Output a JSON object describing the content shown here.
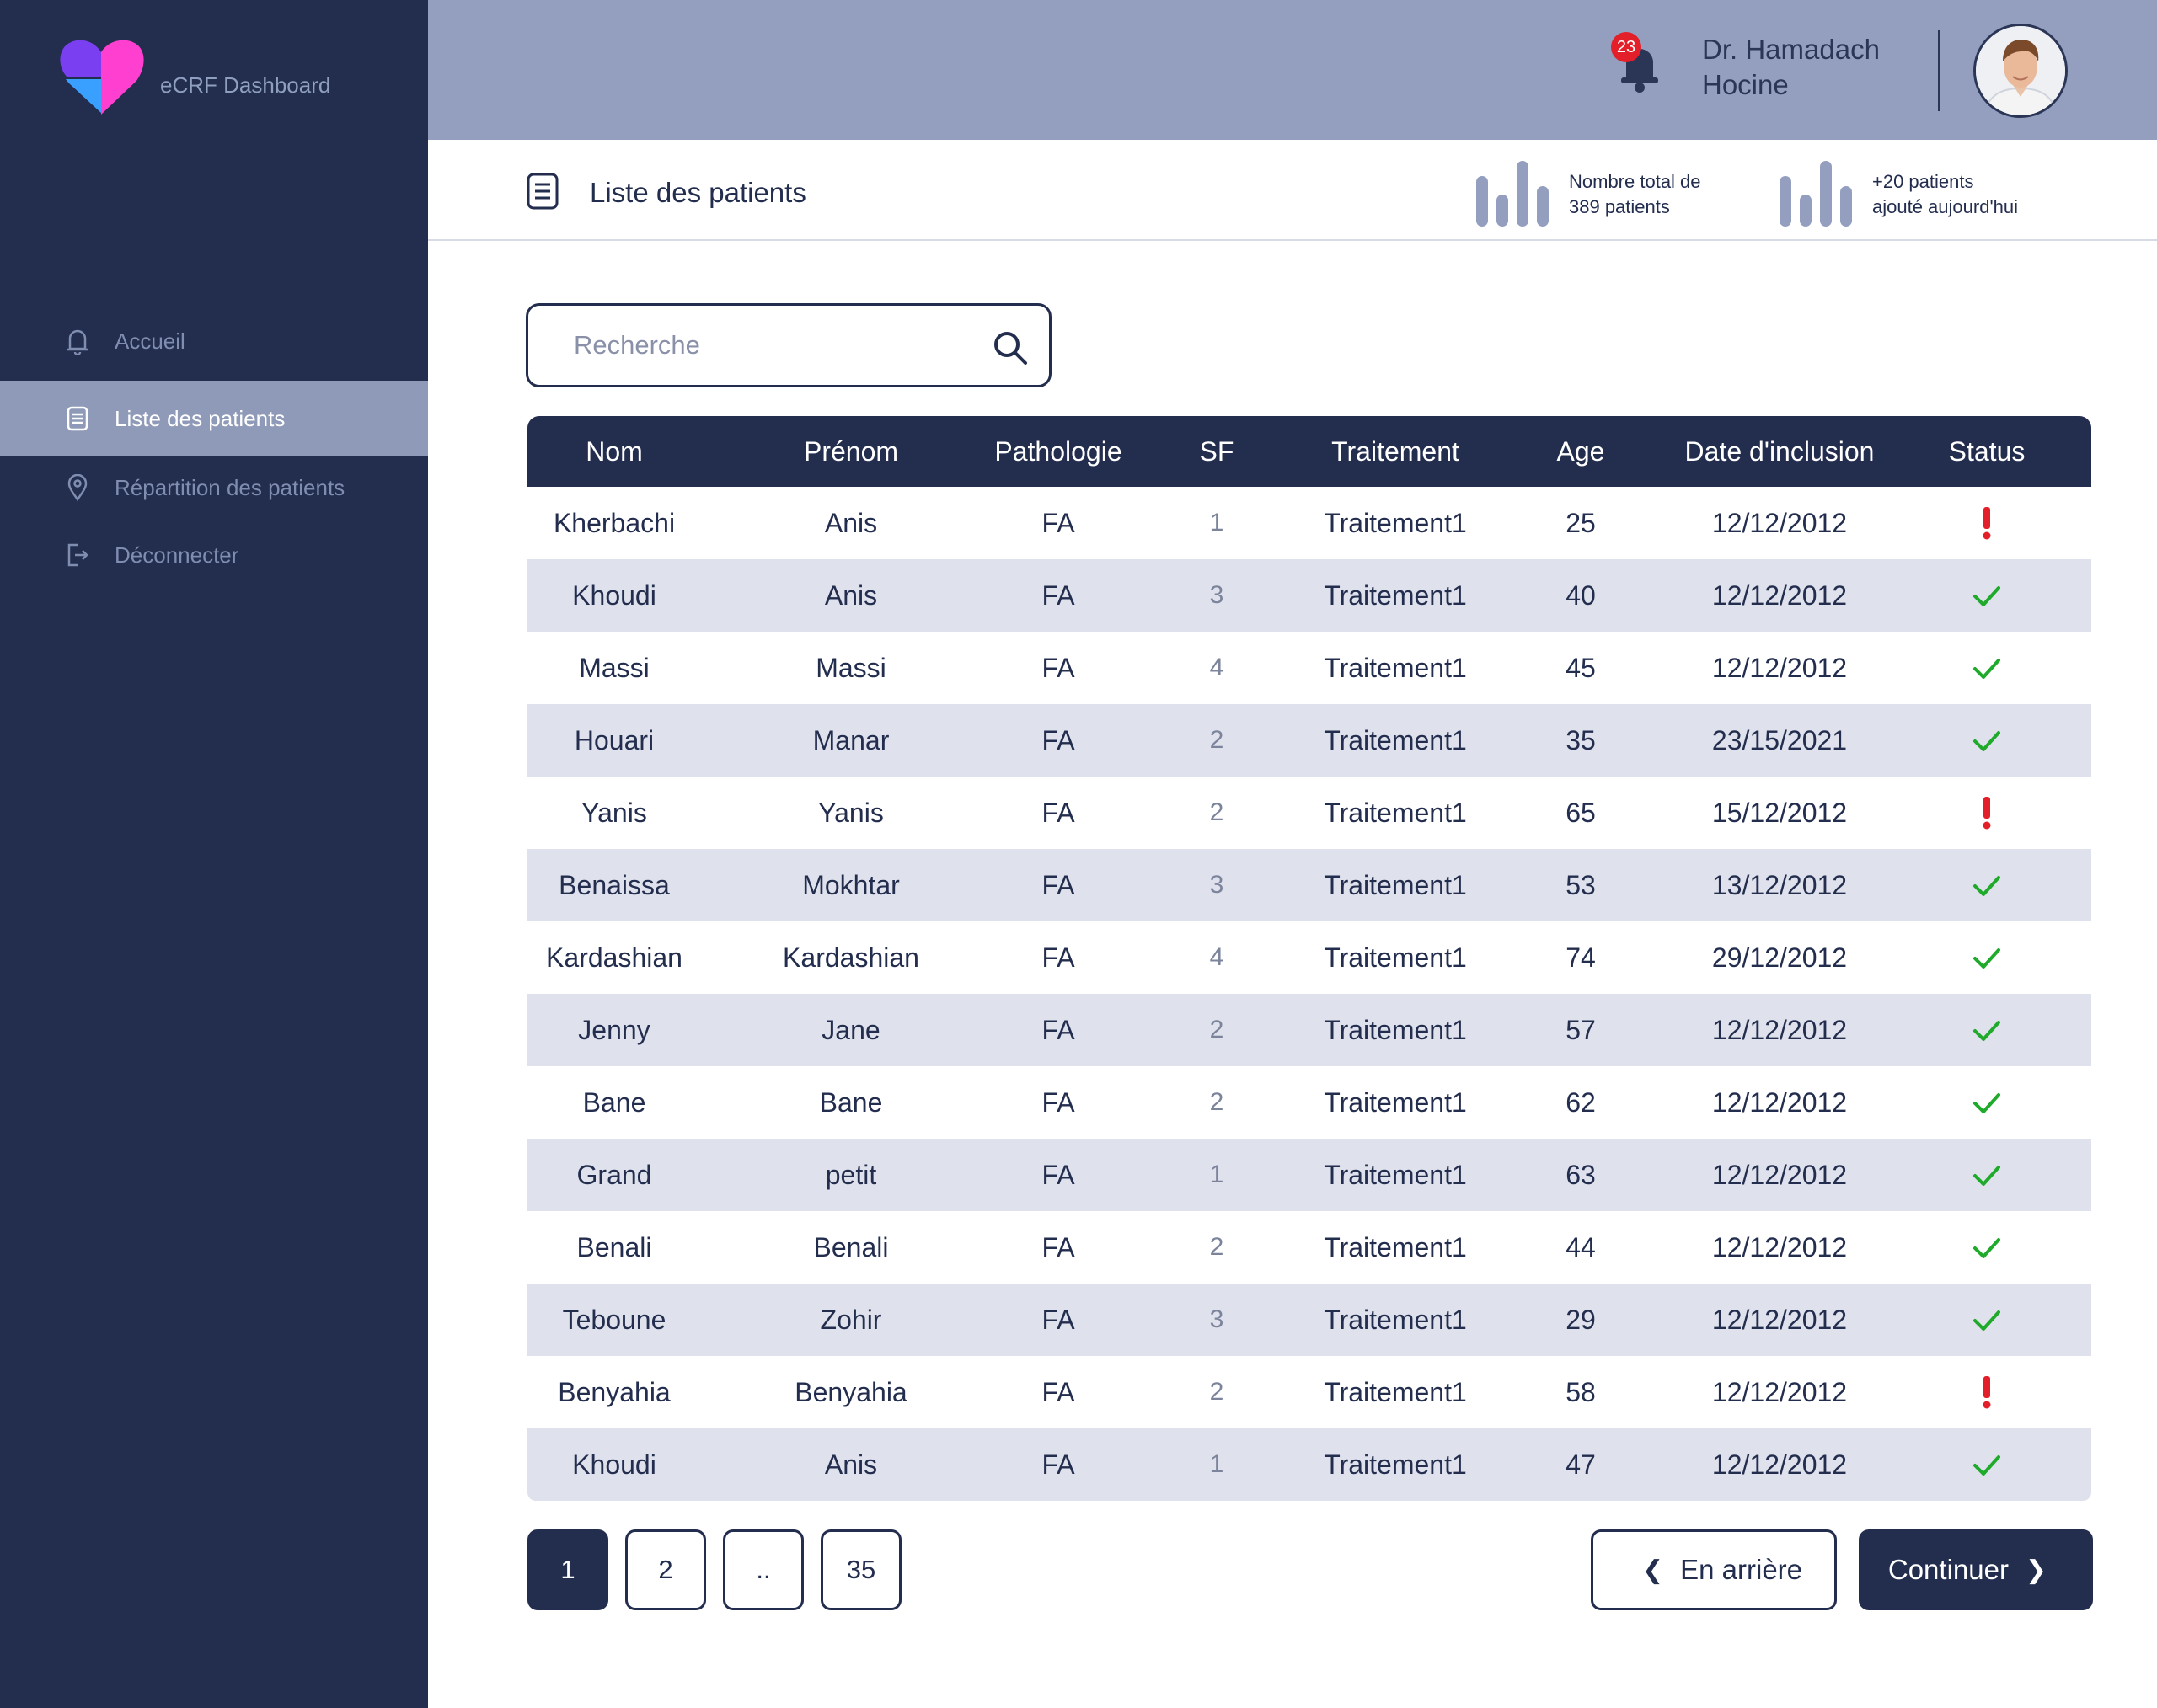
{
  "app": {
    "name": "eCRF Dashboard"
  },
  "sidebar": {
    "items": [
      {
        "label": "Accueil",
        "icon": "bell-outline-icon",
        "active": false
      },
      {
        "label": "Liste des patients",
        "icon": "list-icon",
        "active": true
      },
      {
        "label": "Répartition  des patients",
        "icon": "location-pin-icon",
        "active": false
      },
      {
        "label": "Déconnecter",
        "icon": "logout-icon",
        "active": false
      }
    ]
  },
  "header": {
    "notification_count": "23",
    "doctor_name_line1": "Dr. Hamadach",
    "doctor_name_line2": "Hocine"
  },
  "subheader": {
    "title": "Liste des patients",
    "stat_total_line1": "Nombre total de",
    "stat_total_line2": "389 patients",
    "stat_added_line1": "+20 patients",
    "stat_added_line2": "ajouté aujourd'hui"
  },
  "search": {
    "placeholder": "Recherche"
  },
  "table": {
    "columns": [
      "Nom",
      "Prénom",
      "Pathologie",
      "SF",
      "Traitement",
      "Age",
      "Date d'inclusion",
      "Status"
    ],
    "rows": [
      {
        "nom": "Kherbachi",
        "prenom": "Anis",
        "pathologie": "FA",
        "sf": "1",
        "traitement": "Traitement1",
        "age": "25",
        "date": "12/12/2012",
        "status": "warning"
      },
      {
        "nom": "Khoudi",
        "prenom": "Anis",
        "pathologie": "FA",
        "sf": "3",
        "traitement": "Traitement1",
        "age": "40",
        "date": "12/12/2012",
        "status": "ok"
      },
      {
        "nom": "Massi",
        "prenom": "Massi",
        "pathologie": "FA",
        "sf": "4",
        "traitement": "Traitement1",
        "age": "45",
        "date": "12/12/2012",
        "status": "ok"
      },
      {
        "nom": "Houari",
        "prenom": "Manar",
        "pathologie": "FA",
        "sf": "2",
        "traitement": "Traitement1",
        "age": "35",
        "date": "23/15/2021",
        "status": "ok"
      },
      {
        "nom": "Yanis",
        "prenom": "Yanis",
        "pathologie": "FA",
        "sf": "2",
        "traitement": "Traitement1",
        "age": "65",
        "date": "15/12/2012",
        "status": "warning"
      },
      {
        "nom": "Benaissa",
        "prenom": "Mokhtar",
        "pathologie": "FA",
        "sf": "3",
        "traitement": "Traitement1",
        "age": "53",
        "date": "13/12/2012",
        "status": "ok"
      },
      {
        "nom": "Kardashian",
        "prenom": "Kardashian",
        "pathologie": "FA",
        "sf": "4",
        "traitement": "Traitement1",
        "age": "74",
        "date": "29/12/2012",
        "status": "ok"
      },
      {
        "nom": "Jenny",
        "prenom": "Jane",
        "pathologie": "FA",
        "sf": "2",
        "traitement": "Traitement1",
        "age": "57",
        "date": "12/12/2012",
        "status": "ok"
      },
      {
        "nom": "Bane",
        "prenom": "Bane",
        "pathologie": "FA",
        "sf": "2",
        "traitement": "Traitement1",
        "age": "62",
        "date": "12/12/2012",
        "status": "ok"
      },
      {
        "nom": "Grand",
        "prenom": "petit",
        "pathologie": "FA",
        "sf": "1",
        "traitement": "Traitement1",
        "age": "63",
        "date": "12/12/2012",
        "status": "ok"
      },
      {
        "nom": "Benali",
        "prenom": "Benali",
        "pathologie": "FA",
        "sf": "2",
        "traitement": "Traitement1",
        "age": "44",
        "date": "12/12/2012",
        "status": "ok"
      },
      {
        "nom": "Teboune",
        "prenom": "Zohir",
        "pathologie": "FA",
        "sf": "3",
        "traitement": "Traitement1",
        "age": "29",
        "date": "12/12/2012",
        "status": "ok"
      },
      {
        "nom": "Benyahia",
        "prenom": "Benyahia",
        "pathologie": "FA",
        "sf": "2",
        "traitement": "Traitement1",
        "age": "58",
        "date": "12/12/2012",
        "status": "warning"
      },
      {
        "nom": "Khoudi",
        "prenom": "Anis",
        "pathologie": "FA",
        "sf": "1",
        "traitement": "Traitement1",
        "age": "47",
        "date": "12/12/2012",
        "status": "ok"
      }
    ]
  },
  "pagination": {
    "pages": [
      "1",
      "2",
      "..",
      "35"
    ],
    "current": "1",
    "back_label": "En arrière",
    "next_label": "Continuer"
  },
  "colors": {
    "sidebar_bg": "#232d4e",
    "header_bg": "#949fbf",
    "accent_navy": "#232d4e",
    "status_ok": "#1faa2b",
    "status_warning": "#e3202a",
    "notification_badge": "#e3202a",
    "logo_purple": "#7b3ff2",
    "logo_pink": "#ff3fd0",
    "logo_blue": "#3aa0ff"
  }
}
